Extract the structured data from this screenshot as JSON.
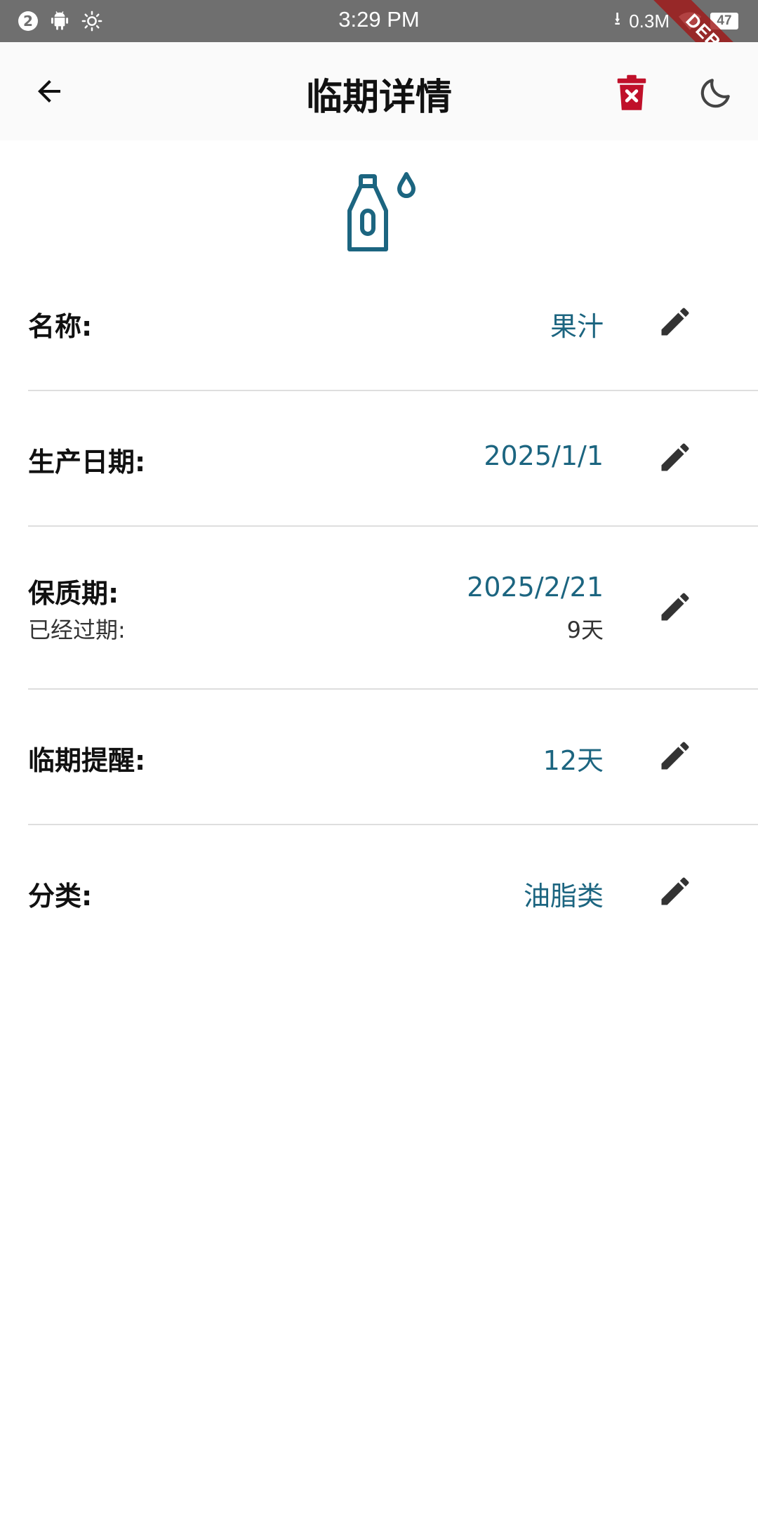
{
  "status_bar": {
    "notification_count": "2",
    "time": "3:29 PM",
    "network_speed": "0.3M",
    "battery": "47"
  },
  "debug_banner": "DEBUG",
  "app_bar": {
    "title": "临期详情",
    "back_icon": "arrow-back-icon",
    "delete_icon": "delete-forever-icon",
    "theme_icon": "dark-mode-moon-icon",
    "delete_color": "#c0102a"
  },
  "product": {
    "icon": "oil-bottle-icon",
    "icon_color": "#1c6580"
  },
  "details": {
    "name": {
      "label": "名称:",
      "value": "果汁"
    },
    "production_date": {
      "label": "生产日期:",
      "value": "2025/1/1"
    },
    "expiry": {
      "label": "保质期:",
      "value": "2025/2/21",
      "sub_label": "已经过期:",
      "sub_value": "9天"
    },
    "reminder": {
      "label": "临期提醒:",
      "value": "12天"
    },
    "category": {
      "label": "分类:",
      "value": "油脂类"
    }
  },
  "colors": {
    "accent": "#1c6580",
    "edit_icon": "#333333",
    "divider": "#dedede"
  }
}
